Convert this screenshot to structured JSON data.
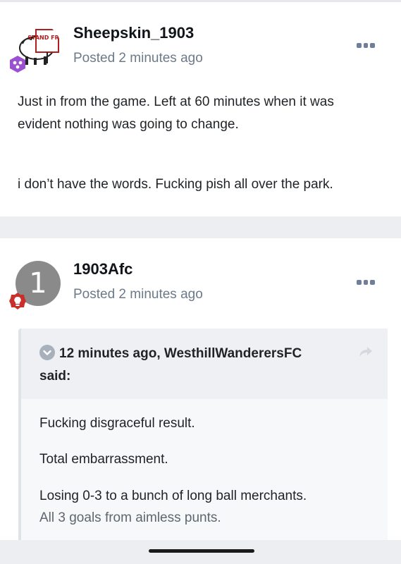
{
  "posts": [
    {
      "username": "Sheepskin_1903",
      "posted": "Posted 2 minutes ago",
      "avatar_sign": "STAND FREE",
      "paragraphs": [
        "Just in from the game. Left at 60 minutes when it was",
        "evident nothing was going to change.",
        "i don’t have the words. Fucking pish all over the park."
      ]
    },
    {
      "username": "1903Afc",
      "posted": "Posted 2 minutes ago",
      "avatar_letter": "1",
      "quote": {
        "header_line1": "12 minutes ago, WesthillWanderersFC",
        "header_line2": "said:",
        "lines": [
          "Fucking disgraceful result.",
          "Total embarrassment.",
          "Losing 0-3 to a bunch of long ball merchants.",
          "All 3 goals from aimless punts."
        ]
      }
    }
  ],
  "icons": {
    "menu": "more-horizontal-icon",
    "badge1": "purple-hexagon-badge-icon",
    "badge2": "red-lightbulb-badge-icon",
    "quote_toggle": "chevron-down-icon",
    "quote_link": "share-arrow-icon"
  },
  "colors": {
    "username": "#111418",
    "meta": "#6c7a89",
    "menu_dots": "#6f7e9a",
    "badge_purple": "#9b4fd1",
    "badge_red": "#c9302c",
    "page_bg": "#eceef1"
  }
}
